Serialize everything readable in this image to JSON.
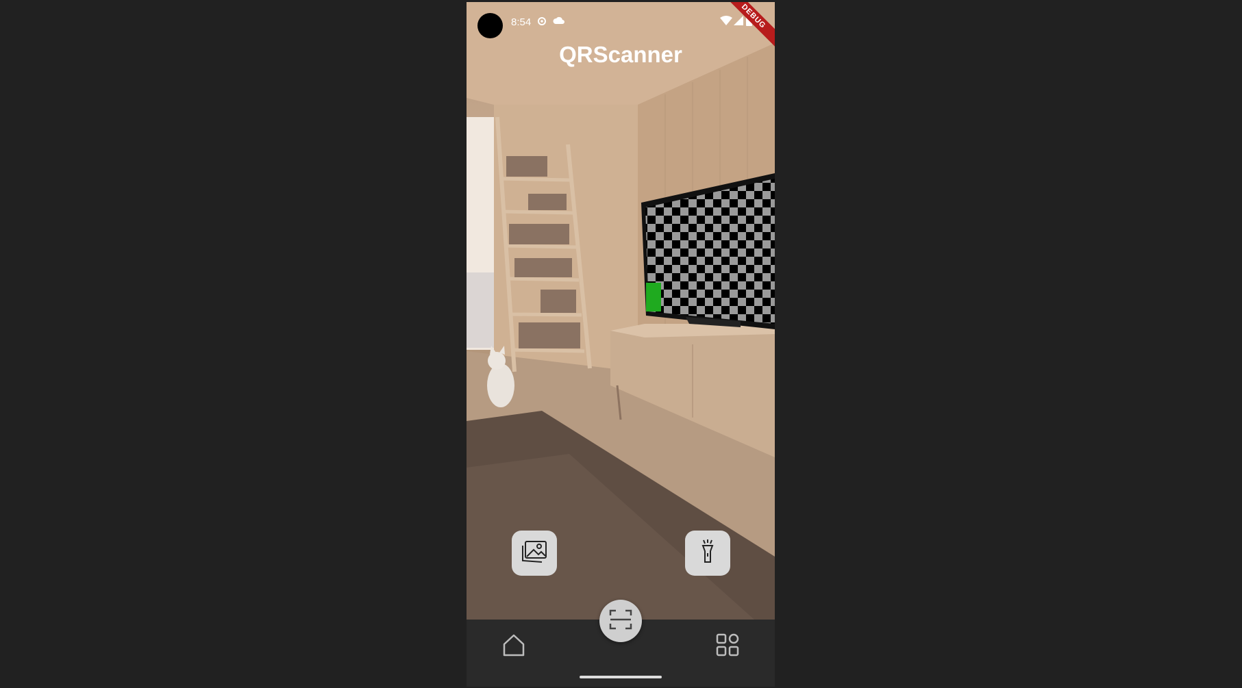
{
  "status_bar": {
    "time": "8:54"
  },
  "app_bar": {
    "title": "QRScanner",
    "debug_banner": "DEBUG"
  },
  "camera_view": {
    "preview_description_icon": "camera-preview"
  },
  "actions": {
    "gallery_icon": "image-gallery-icon",
    "flashlight_icon": "flashlight-icon"
  },
  "bottom_nav": {
    "home_icon": "home-icon",
    "scan_icon": "scan-frame-icon",
    "apps_icon": "grid-icon"
  },
  "colors": {
    "background": "#212121",
    "nav_background": "#2a2a2a",
    "button_bg": "#d9d9d9",
    "debug_banner": "#b71c1c"
  }
}
